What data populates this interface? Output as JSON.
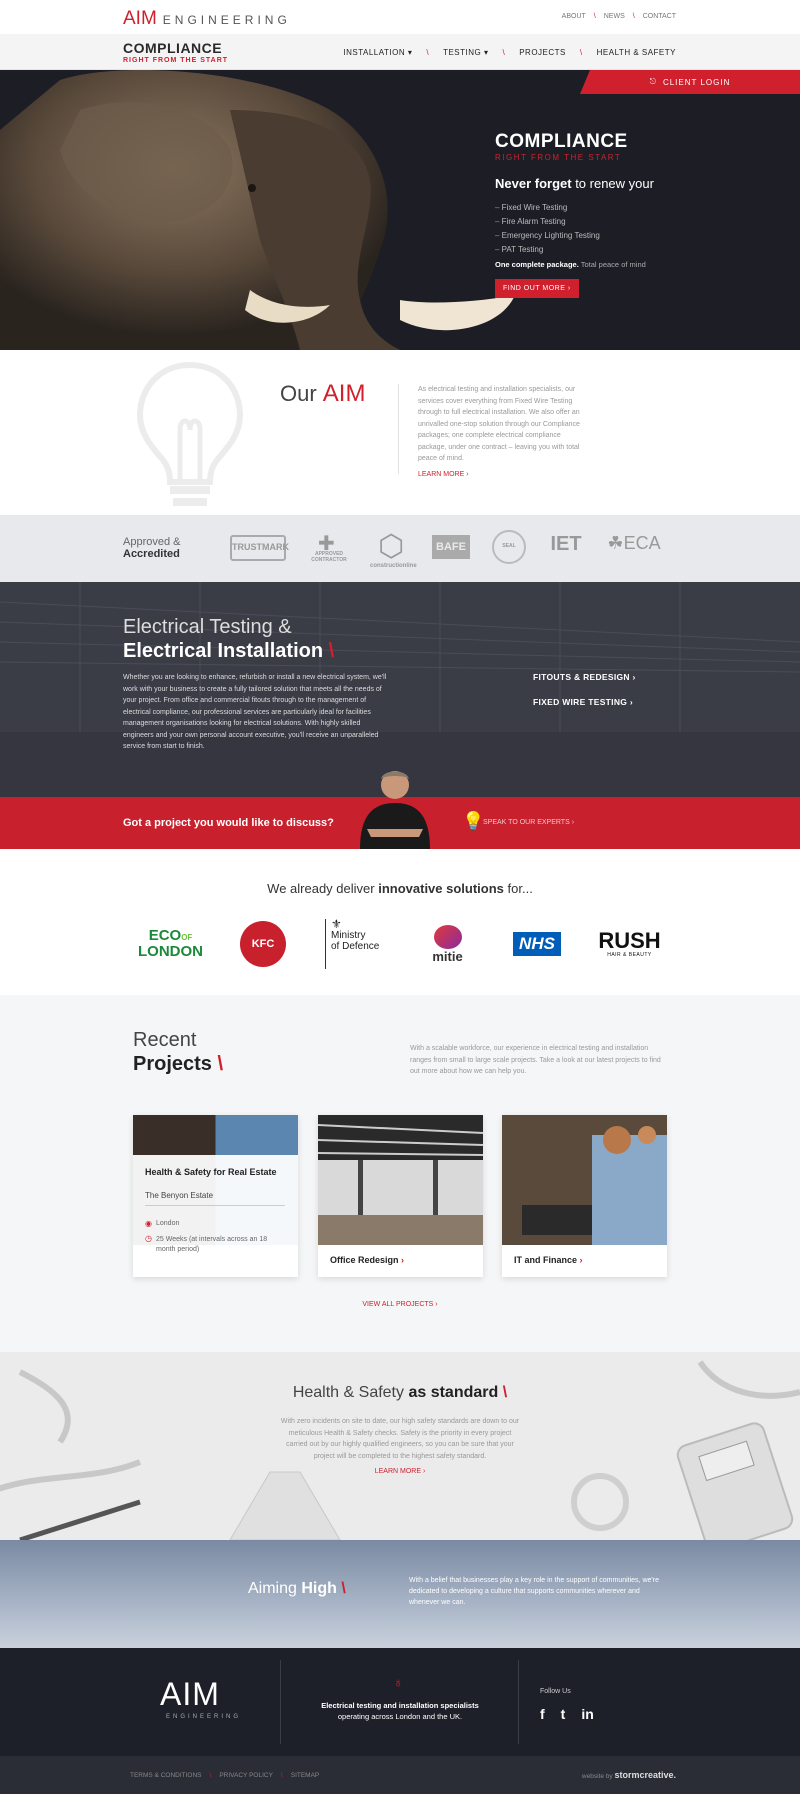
{
  "topbar": {
    "logo_aim": "AIM",
    "logo_eng": "ENGINEERING",
    "links": [
      "ABOUT",
      "NEWS",
      "CONTACT"
    ],
    "sep": "\\"
  },
  "nav": {
    "logo_line1": "COMPLIANCE",
    "logo_line2": "RIGHT FROM THE START",
    "items": [
      "INSTALLATION ▾",
      "TESTING ▾",
      "PROJECTS",
      "HEALTH & SAFETY"
    ],
    "sep": "\\"
  },
  "hero": {
    "client_login": "CLIENT LOGIN",
    "brand_line1": "COMPLIANCE",
    "brand_line2": "RIGHT FROM THE START",
    "never_bold": "Never forget",
    "never_rest": " to renew your",
    "list": [
      "Fixed Wire Testing",
      "Fire Alarm Testing",
      "Emergency Lighting Testing",
      "PAT Testing"
    ],
    "pkg_bold": "One complete package.",
    "pkg_rest": " Total peace of mind",
    "cta": "FIND OUT MORE  ›"
  },
  "our_aim": {
    "title_our": "Our ",
    "title_aim": "AIM",
    "text": "As electrical testing and installation specialists, our services cover everything from Fixed Wire Testing through to full electrical installation. We also offer an unrivalled one-stop solution through our Compliance packages; one complete electrical compliance package, under one contract – leaving you with total peace of mind.",
    "learn_more": "LEARN MORE ›"
  },
  "accredited": {
    "label_line1": "Approved &",
    "label_line2": "Accredited",
    "logos": [
      "TRUSTMARK",
      "APPROVED CONTRACTOR",
      "constructionline",
      "BAFE",
      "SEAL",
      "IET",
      "ECA"
    ]
  },
  "electrical": {
    "title_line1": "Electrical Testing &",
    "title_line2": "Electrical Installation",
    "slash": "\\",
    "text": "Whether you are looking to enhance, refurbish or install a new electrical system, we'll work with your business to create a fully tailored solution that meets all the needs of your project. From office and commercial fitouts through to the management of electrical compliance, our professional services are particularly ideal for facilities management organisations looking for electrical solutions. With highly skilled engineers and your own personal account executive, you'll receive an unparalleled service from start to finish.",
    "link1": "FITOUTS & REDESIGN ›",
    "link2": "FIXED WIRE TESTING ›"
  },
  "discuss": {
    "question": "Got a project you would like to discuss?",
    "speak": "SPEAK TO OUR EXPERTS ›"
  },
  "clients": {
    "heading_pre": "We already deliver ",
    "heading_bold": "innovative solutions",
    "heading_post": " for...",
    "names": [
      "ECO OF LONDON",
      "KFC",
      "Ministry of Defence",
      "mitie",
      "NHS",
      "RUSH"
    ],
    "rush_sub": "HAIR & BEAUTY",
    "eco_line1": "ECO",
    "eco_of": "OF",
    "eco_line2": "LONDON",
    "mod_line1": "Ministry",
    "mod_line2": "of Defence"
  },
  "projects": {
    "title_line1": "Recent",
    "title_line2": "Projects",
    "slash": "\\",
    "desc": "With a scalable workforce, our experience in electrical testing and installation ranges from small to large scale projects. Take a look at our latest projects to find out more about how we can help you.",
    "cards": [
      {
        "title": "Health & Safety for Real Estate",
        "subtitle": "The Benyon Estate",
        "location": "London",
        "duration": "25 Weeks (at intervals across an 18 month period)"
      },
      {
        "title": "Office Redesign"
      },
      {
        "title": "IT and Finance"
      }
    ],
    "view_all": "VIEW ALL PROJECTS ›"
  },
  "health": {
    "title_pre": "Health & Safety ",
    "title_bold": "as standard",
    "slash": "\\",
    "text": "With zero incidents on site to date, our high safety standards are down to our meticulous Health & Safety checks. Safety is the priority in every project carried out by our highly qualified engineers, so you can be sure that your project will be completed to the highest safety standard.",
    "learn_more": "LEARN MORE ›"
  },
  "aiming": {
    "title_pre": "Aiming ",
    "title_bold": "High",
    "slash": "\\",
    "text": "With a belief that businesses play a key role in the support of communities, we're dedicated to developing a culture that supports communities wherever and whenever we can."
  },
  "footer": {
    "logo": "AIM",
    "logo_sub": "ENGINEERING",
    "tagline_bold": "Electrical testing and installation specialists",
    "tagline_rest": "operating across London and the UK.",
    "follow": "Follow Us",
    "social": [
      "f",
      "t",
      "in"
    ]
  },
  "bottom": {
    "links": [
      "TERMS & CONDITIONS",
      "PRIVACY POLICY",
      "SITEMAP"
    ],
    "by_pre": "website by ",
    "by_bold": "stormcreative."
  },
  "colors": {
    "accent": "#d0202e",
    "dark": "#1e2029"
  }
}
